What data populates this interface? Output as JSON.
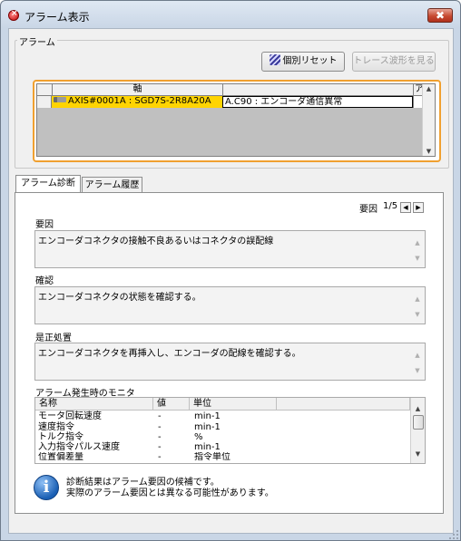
{
  "window": {
    "title": "アラーム表示",
    "close_label": "✖"
  },
  "alarm_group": {
    "label": "アラーム",
    "reset_button": "個別リセット",
    "trace_button": "トレース波形を見る",
    "grid": {
      "headers": [
        "",
        "軸",
        "",
        "ア"
      ],
      "rows": [
        {
          "axis": "AXIS#0001A : SGD7S-2R8A20A",
          "alarm": "A.C90 : エンコーダ通信異常"
        }
      ]
    }
  },
  "tabs": [
    {
      "label": "アラーム診断",
      "active": true
    },
    {
      "label": "アラーム履歴",
      "active": false
    }
  ],
  "diagnosis": {
    "page_label": "要因",
    "page_value": "1/5",
    "cause": {
      "label": "要因",
      "text": "エンコーダコネクタの接触不良あるいはコネクタの誤配線"
    },
    "check": {
      "label": "確認",
      "text": "エンコーダコネクタの状態を確認する。"
    },
    "remedy": {
      "label": "是正処置",
      "text": "エンコーダコネクタを再挿入し、エンコーダの配線を確認する。"
    },
    "monitor": {
      "label": "アラーム発生時のモニタ",
      "columns": [
        "名称",
        "値",
        "単位"
      ],
      "rows": [
        {
          "name": "モータ回転速度",
          "value": "-",
          "unit": "min-1"
        },
        {
          "name": "速度指令",
          "value": "-",
          "unit": "min-1"
        },
        {
          "name": "トルク指令",
          "value": "-",
          "unit": "%"
        },
        {
          "name": "入力指令パルス速度",
          "value": "-",
          "unit": "min-1"
        },
        {
          "name": "位置偏差量",
          "value": "-",
          "unit": "指令単位"
        }
      ]
    },
    "note_line1": "診断結果はアラーム要因の候補です。",
    "note_line2": "実際のアラーム要因とは異なる可能性があります。"
  },
  "colors": {
    "highlight_row": "#ffd400",
    "frame_accent": "#f0a030",
    "title_bg": "#c9d6e6"
  }
}
